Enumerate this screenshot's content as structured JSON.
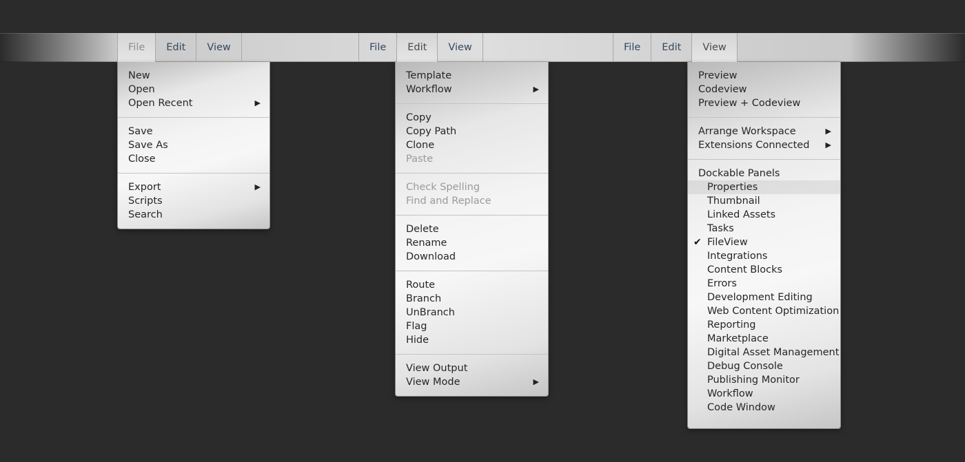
{
  "menubars": [
    {
      "items": [
        "File",
        "Edit",
        "View"
      ]
    },
    {
      "items": [
        "File",
        "Edit",
        "View"
      ]
    },
    {
      "items": [
        "File",
        "Edit",
        "View"
      ]
    }
  ],
  "file_menu": {
    "groups": [
      [
        {
          "label": "New"
        },
        {
          "label": "Open"
        },
        {
          "label": "Open Recent",
          "submenu": true
        }
      ],
      [
        {
          "label": "Save"
        },
        {
          "label": "Save As"
        },
        {
          "label": "Close"
        }
      ],
      [
        {
          "label": "Export",
          "submenu": true
        },
        {
          "label": "Scripts"
        },
        {
          "label": "Search"
        }
      ]
    ]
  },
  "edit_menu": {
    "groups": [
      [
        {
          "label": "Template"
        },
        {
          "label": "Workflow",
          "submenu": true
        }
      ],
      [
        {
          "label": "Copy"
        },
        {
          "label": "Copy Path"
        },
        {
          "label": "Clone"
        },
        {
          "label": "Paste",
          "disabled": true
        }
      ],
      [
        {
          "label": "Check Spelling",
          "disabled": true
        },
        {
          "label": "Find and Replace",
          "disabled": true
        }
      ],
      [
        {
          "label": "Delete"
        },
        {
          "label": "Rename"
        },
        {
          "label": "Download"
        }
      ],
      [
        {
          "label": "Route"
        },
        {
          "label": "Branch"
        },
        {
          "label": "UnBranch"
        },
        {
          "label": "Flag"
        },
        {
          "label": "Hide"
        }
      ],
      [
        {
          "label": "View Output"
        },
        {
          "label": "View Mode",
          "submenu": true
        }
      ]
    ]
  },
  "view_menu": {
    "groups": [
      [
        {
          "label": "Preview"
        },
        {
          "label": "Codeview"
        },
        {
          "label": "Preview + Codeview"
        }
      ],
      [
        {
          "label": "Arrange Workspace",
          "submenu": true
        },
        {
          "label": "Extensions Connected",
          "submenu": true
        }
      ],
      [
        {
          "label": "Dockable Panels"
        },
        {
          "label": "Properties",
          "indent": true,
          "highlighted": true
        },
        {
          "label": "Thumbnail",
          "indent": true
        },
        {
          "label": "Linked Assets",
          "indent": true
        },
        {
          "label": "Tasks",
          "indent": true
        },
        {
          "label": "FileView",
          "indent": true,
          "checked": true
        },
        {
          "label": "Integrations",
          "indent": true
        },
        {
          "label": "Content Blocks",
          "indent": true
        },
        {
          "label": "Errors",
          "indent": true
        },
        {
          "label": "Development Editing",
          "indent": true
        },
        {
          "label": "Web Content Optimization",
          "indent": true
        },
        {
          "label": "Reporting",
          "indent": true
        },
        {
          "label": "Marketplace",
          "indent": true
        },
        {
          "label": "Digital Asset Management",
          "indent": true
        },
        {
          "label": "Debug Console",
          "indent": true
        },
        {
          "label": "Publishing Monitor",
          "indent": true
        },
        {
          "label": "Workflow",
          "indent": true
        },
        {
          "label": "Code Window",
          "indent": true
        }
      ]
    ]
  }
}
